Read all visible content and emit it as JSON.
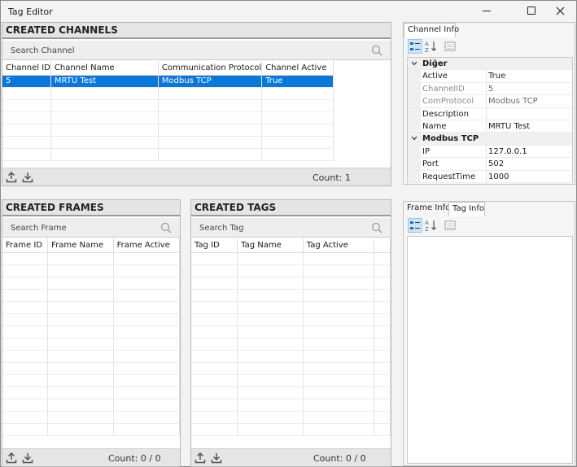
{
  "window": {
    "title": "Tag Editor"
  },
  "channels": {
    "header": "CREATED CHANNELS",
    "search_placeholder": "Search Channel",
    "columns": [
      "Channel ID",
      "Channel Name",
      "Communication Protocol",
      "Channel Active"
    ],
    "rows": [
      [
        "5",
        "MRTU Test",
        "Modbus TCP",
        "True"
      ]
    ],
    "count": "Count: 1"
  },
  "frames": {
    "header": "CREATED FRAMES",
    "search_placeholder": "Search Frame",
    "columns": [
      "Frame ID",
      "Frame Name",
      "Frame Active"
    ],
    "count": "Count: 0 / 0"
  },
  "tags": {
    "header": "CREATED TAGS",
    "search_placeholder": "Search Tag",
    "columns": [
      "Tag ID",
      "Tag Name",
      "Tag Active"
    ],
    "count": "Count: 0 / 0"
  },
  "channel_info": {
    "tab": "Channel Info",
    "categories": [
      {
        "name": "Diğer",
        "props": [
          {
            "name": "Active",
            "value": "True",
            "dim": false
          },
          {
            "name": "ChannelID",
            "value": "5",
            "dim": true
          },
          {
            "name": "ComProtocol",
            "value": "Modbus TCP",
            "dim": true
          },
          {
            "name": "Description",
            "value": "",
            "dim": false
          },
          {
            "name": "Name",
            "value": "MRTU Test",
            "dim": false
          }
        ]
      },
      {
        "name": "Modbus TCP",
        "props": [
          {
            "name": "IP",
            "value": "127.0.0.1",
            "dim": false
          },
          {
            "name": "Port",
            "value": "502",
            "dim": false
          },
          {
            "name": "RequestTime",
            "value": "1000",
            "dim": false
          }
        ]
      }
    ]
  },
  "lower_info": {
    "tabs": [
      {
        "label": "Frame Info",
        "active": false
      },
      {
        "label": "Tag Info",
        "active": true
      }
    ]
  },
  "colors": {
    "selection": "#0b78d7",
    "accent": "#0b78d7"
  },
  "icons": [
    "minimize-icon",
    "maximize-icon",
    "close-icon",
    "search-icon",
    "upload-icon",
    "download-icon",
    "categorized-icon",
    "sort-alpha-icon",
    "property-pages-icon"
  ]
}
